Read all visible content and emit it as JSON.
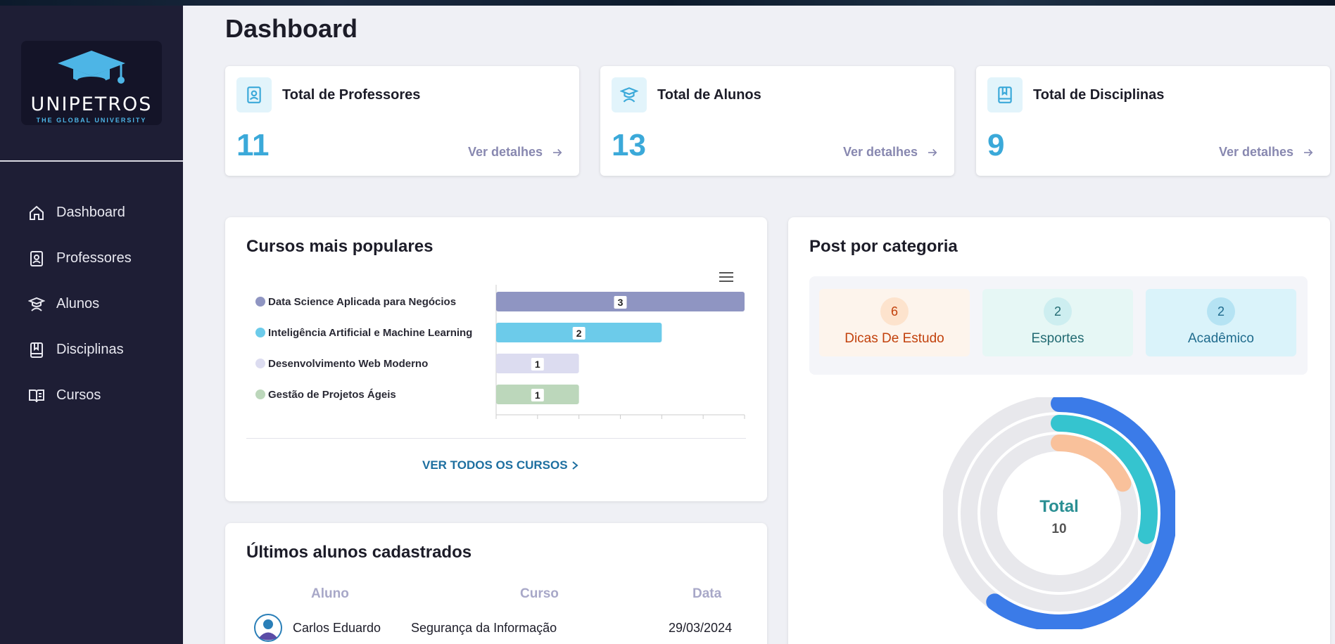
{
  "brand": {
    "name": "UNIPETROS",
    "tagline": "THE GLOBAL UNIVERSITY"
  },
  "sidebar": {
    "items": [
      {
        "label": "Dashboard",
        "icon": "home-icon"
      },
      {
        "label": "Professores",
        "icon": "id-badge-icon"
      },
      {
        "label": "Alunos",
        "icon": "graduate-icon"
      },
      {
        "label": "Disciplinas",
        "icon": "book-icon"
      },
      {
        "label": "Cursos",
        "icon": "open-book-icon"
      }
    ]
  },
  "page": {
    "title": "Dashboard"
  },
  "stats": [
    {
      "label": "Total de Professores",
      "value": "11",
      "link": "Ver detalhes",
      "icon": "id-badge-icon"
    },
    {
      "label": "Total de Alunos",
      "value": "13",
      "link": "Ver detalhes",
      "icon": "graduate-icon"
    },
    {
      "label": "Total de Disciplinas",
      "value": "9",
      "link": "Ver detalhes",
      "icon": "book-icon"
    }
  ],
  "courses_card": {
    "title": "Cursos mais populares",
    "link": "VER TODOS OS CURSOS"
  },
  "chart_data": [
    {
      "type": "bar",
      "orientation": "horizontal",
      "categories": [
        "Data Science Aplicada para Negócios",
        "Inteligência Artificial e Machine Learning",
        "Desenvolvimento Web Moderno",
        "Gestão de Projetos Ágeis"
      ],
      "values": [
        3,
        2,
        1,
        1
      ],
      "colors": [
        "#8f95c2",
        "#6ccbea",
        "#dcdcf0",
        "#bcd7bb"
      ],
      "xlim": [
        0,
        3
      ],
      "legend_position": "left",
      "data_labels": true
    },
    {
      "type": "radial-bar",
      "categories": [
        "Dicas De Estudo",
        "Esportes",
        "Acadêmico"
      ],
      "values": [
        6,
        2,
        2
      ],
      "total_label": "Total",
      "total_value": "10",
      "colors": [
        "#f9c19b",
        "#35c4cf",
        "#3b7be8"
      ]
    }
  ],
  "posts_card": {
    "title": "Post por categoria",
    "categories": [
      {
        "name": "Dicas De Estudo",
        "count": "6",
        "bg": "#fdf4ec",
        "badge_bg": "#fde3cd",
        "color": "#c2410c"
      },
      {
        "name": "Esportes",
        "count": "2",
        "bg": "#e6f7f5",
        "badge_bg": "#cdeef0",
        "color": "#236b73"
      },
      {
        "name": "Acadêmico",
        "count": "2",
        "bg": "#daf3fa",
        "badge_bg": "#b5e3f3",
        "color": "#1f6b8d"
      }
    ]
  },
  "students_card": {
    "title": "Últimos alunos cadastrados",
    "columns": [
      "Aluno",
      "Curso",
      "Data"
    ],
    "rows": [
      {
        "name": "Carlos Eduardo",
        "course": "Segurança da Informação",
        "date": "29/03/2024"
      }
    ]
  }
}
